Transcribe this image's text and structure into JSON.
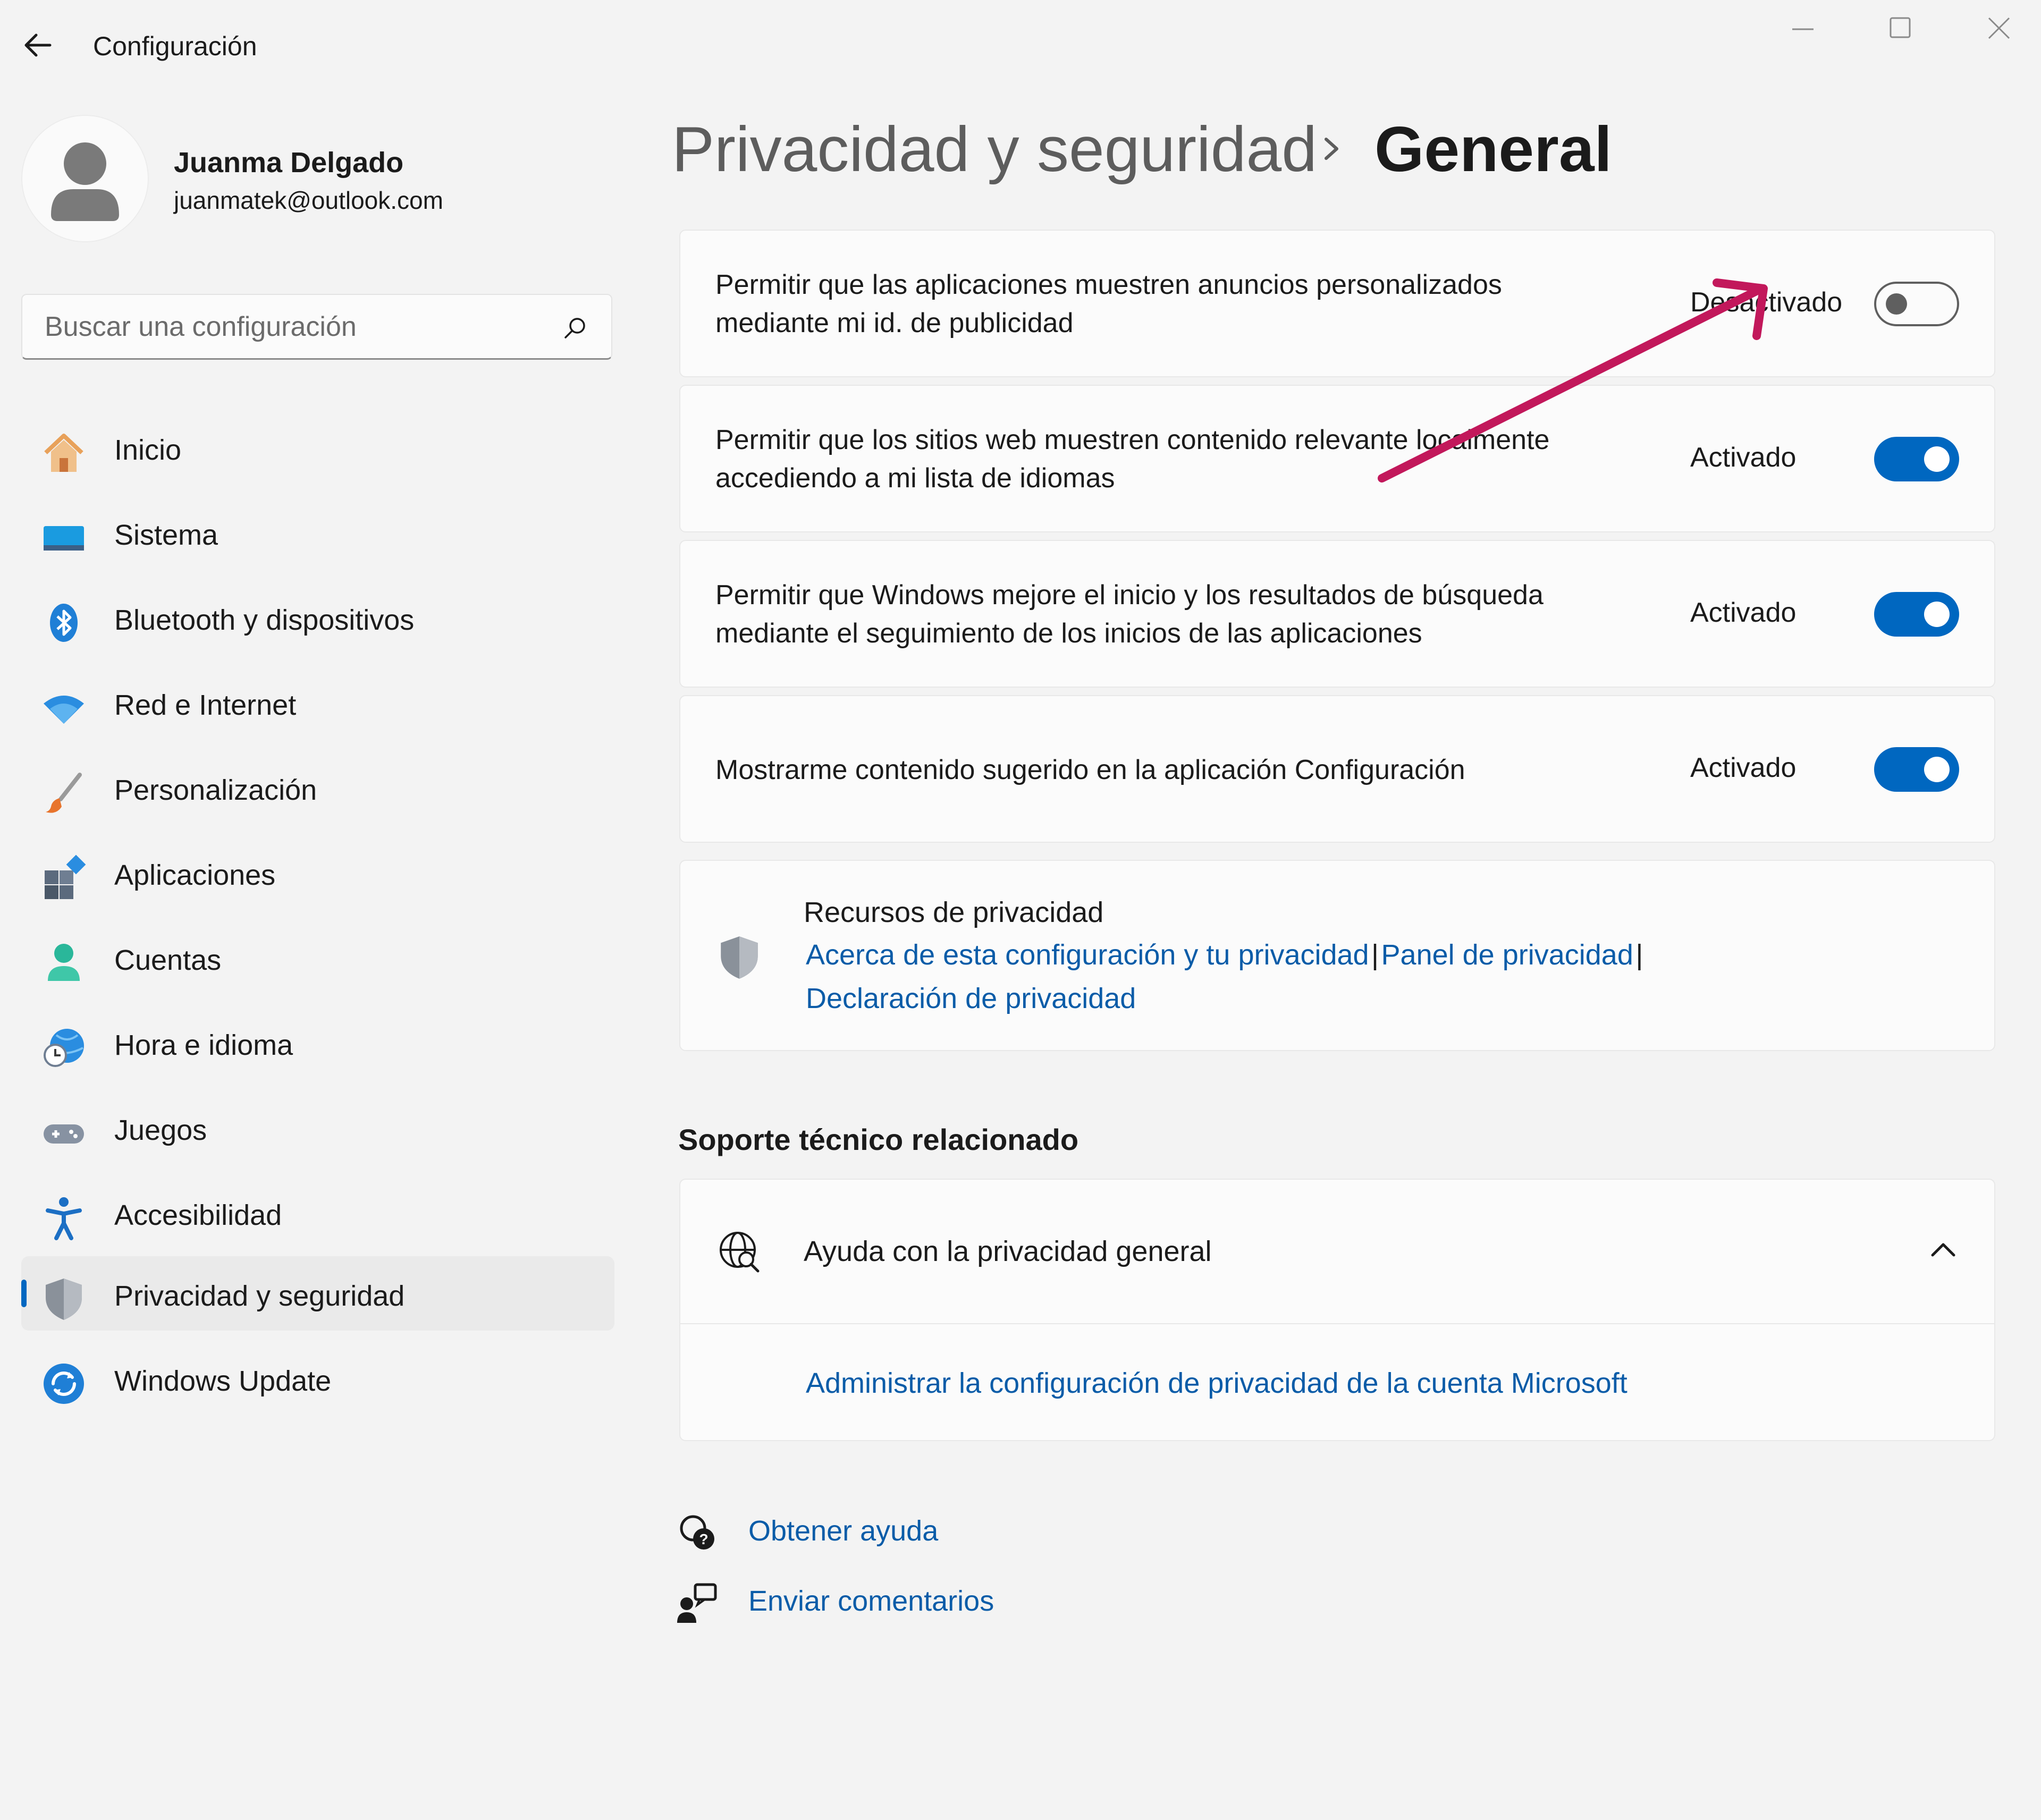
{
  "window": {
    "app_title": "Configuración"
  },
  "user": {
    "name": "Juanma Delgado",
    "email": "juanmatek@outlook.com"
  },
  "search": {
    "placeholder": "Buscar una configuración"
  },
  "nav": {
    "items": [
      {
        "label": "Inicio",
        "icon": "home-icon"
      },
      {
        "label": "Sistema",
        "icon": "monitor-icon"
      },
      {
        "label": "Bluetooth y dispositivos",
        "icon": "bluetooth-icon"
      },
      {
        "label": "Red e Internet",
        "icon": "wifi-icon"
      },
      {
        "label": "Personalización",
        "icon": "brush-icon"
      },
      {
        "label": "Aplicaciones",
        "icon": "apps-icon"
      },
      {
        "label": "Cuentas",
        "icon": "person-icon"
      },
      {
        "label": "Hora e idioma",
        "icon": "globe-clock-icon"
      },
      {
        "label": "Juegos",
        "icon": "gamepad-icon"
      },
      {
        "label": "Accesibilidad",
        "icon": "accessibility-icon"
      },
      {
        "label": "Privacidad y seguridad",
        "icon": "shield-icon",
        "selected": true
      },
      {
        "label": "Windows Update",
        "icon": "update-icon"
      }
    ]
  },
  "header": {
    "parent": "Privacidad y seguridad",
    "current": "General"
  },
  "settings": [
    {
      "line1": "Permitir que las aplicaciones muestren anuncios personalizados",
      "line2": "mediante mi id. de publicidad",
      "state": "Desactivado",
      "on": false
    },
    {
      "line1": "Permitir que los sitios web muestren contenido relevante localmente",
      "line2": "accediendo a mi lista de idiomas",
      "state": "Activado",
      "on": true
    },
    {
      "line1": "Permitir que Windows mejore el inicio y los resultados de búsqueda",
      "line2": "mediante el seguimiento de los inicios de las aplicaciones",
      "state": "Activado",
      "on": true
    },
    {
      "line1": "Mostrarme contenido sugerido en la aplicación Configuración",
      "line2": "",
      "state": "Activado",
      "on": true
    }
  ],
  "resources": {
    "title": "Recursos de privacidad",
    "link1": "Acerca de esta configuración y tu privacidad",
    "separator": "|",
    "link2": "Panel de privacidad",
    "link3": "Declaración de privacidad"
  },
  "support": {
    "section_title": "Soporte técnico relacionado",
    "expander_title": "Ayuda con la privacidad general",
    "link": "Administrar la configuración de privacidad de la cuenta Microsoft"
  },
  "footer": {
    "get_help": "Obtener ayuda",
    "feedback": "Enviar comentarios"
  },
  "colors": {
    "accent": "#0067c0",
    "link": "#0a5ca8",
    "annotation_arrow": "#c2185b"
  }
}
